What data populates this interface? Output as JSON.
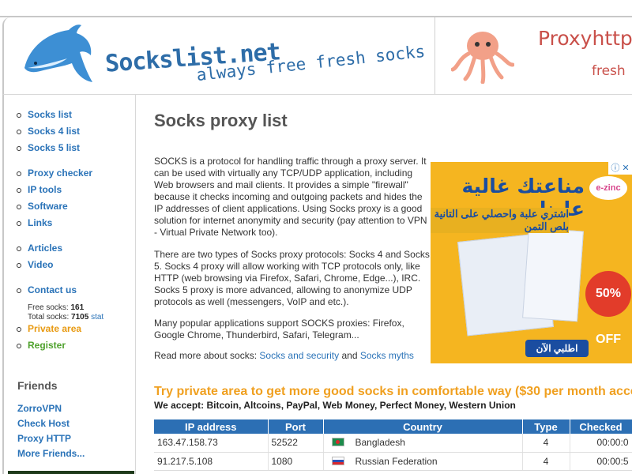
{
  "header": {
    "brand": "Sockslist.net",
    "tagline": "always free fresh socks",
    "partner_brand": "Proxyhttp.",
    "partner_tagline": "fresh"
  },
  "sidebar": {
    "menu": [
      {
        "label": "Socks list"
      },
      {
        "label": "Socks 4 list"
      },
      {
        "label": "Socks 5 list"
      },
      {
        "label": "Proxy checker"
      },
      {
        "label": "IP tools"
      },
      {
        "label": "Software"
      },
      {
        "label": "Links"
      },
      {
        "label": "Articles"
      },
      {
        "label": "Video"
      },
      {
        "label": "Contact us"
      },
      {
        "label": "Private area"
      },
      {
        "label": "Register"
      }
    ],
    "stats": {
      "free_label": "Free socks:",
      "free_value": "161",
      "total_label": "Total socks:",
      "total_value": "7105",
      "stat_link": "stat"
    },
    "friends_heading": "Friends",
    "friends": [
      {
        "label": "ZorroVPN"
      },
      {
        "label": "Check Host"
      },
      {
        "label": "Proxy HTTP"
      },
      {
        "label": "More Friends..."
      }
    ]
  },
  "main": {
    "title": "Socks proxy list",
    "p1": "SOCKS is a protocol for handling traffic through a proxy server. It can be used with virtually any TCP/UDP application, including Web browsers and mail clients. It provides a simple \"firewall\" because it checks incoming and outgoing packets and hides the IP addresses of client applications. Using Socks proxy is a good solution for internet anonymity and security (pay attention to VPN - Virtual Private Network too).",
    "p2": "There are two types of Socks proxy protocols: Socks 4 and Socks 5. Socks 4 proxy will allow working with TCP protocols only, like HTTP (web browsing via Firefox, Safari, Chrome, Edge...), IRC. Socks 5 proxy is more advanced, allowing to anonymize UDP protocols as well (messengers, VoIP and etc.).",
    "p3": "Many popular applications support SOCKS proxies: Firefox, Google Chrome, Thunderbird, Safari, Telegram...",
    "p4_prefix": "Read more about socks:",
    "p4_link1": "Socks and security",
    "p4_and": "and",
    "p4_link2": "Socks myths",
    "promo": "Try private area to get more good socks in comfortable way ($30 per month acce",
    "accept": "We accept: Bitcoin, Altcoins, PayPal, Web Money, Perfect Money, Western Union"
  },
  "ad": {
    "headline": "مناعتك غالية علينا",
    "subline": "اشتري علبة واحصلي على التانية بلص التمن",
    "badge": "50% OFF",
    "cta": "اطلبي الآن",
    "logo": "e-zinc"
  },
  "table": {
    "headers": [
      "IP address",
      "Port",
      "Country",
      "Type",
      "Checked"
    ],
    "rows": [
      {
        "ip": "163.47.158.73",
        "port": "52522",
        "country": "Bangladesh",
        "flag": "bd",
        "type": "4",
        "checked": "00:00:0"
      },
      {
        "ip": "91.217.5.108",
        "port": "1080",
        "country": "Russian Federation",
        "flag": "ru",
        "type": "4",
        "checked": "00:00:5"
      }
    ]
  },
  "colors": {
    "link": "#2a73b8",
    "orange": "#e89a12",
    "green": "#4ea12c",
    "table_header": "#2c6fb4",
    "promo": "#f0a020"
  }
}
